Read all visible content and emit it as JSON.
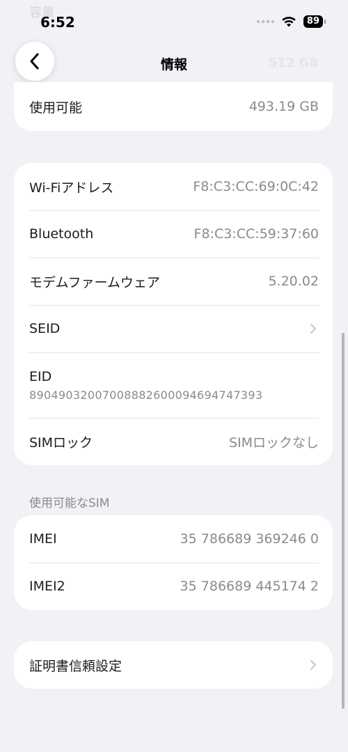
{
  "status_bar": {
    "time": "6:52",
    "battery": "89"
  },
  "ghost": {
    "top_label": "容量",
    "right_value": "512 GB"
  },
  "nav": {
    "title": "情報"
  },
  "storage": {
    "available_label": "使用可能",
    "available_value": "493.19 GB"
  },
  "network": {
    "rows": [
      {
        "label": "Wi-Fiアドレス",
        "value": "F8:C3:CC:69:0C:42"
      },
      {
        "label": "Bluetooth",
        "value": "F8:C3:CC:59:37:60"
      },
      {
        "label": "モデムファームウェア",
        "value": "5.20.02"
      },
      {
        "label": "SEID"
      }
    ],
    "eid": {
      "label": "EID",
      "value": "89049032007008882600094694747393"
    },
    "sim_lock": {
      "label": "SIMロック",
      "value": "SIMロックなし"
    }
  },
  "available_sim": {
    "header": "使用可能なSIM",
    "rows": [
      {
        "label": "IMEI",
        "value": "35 786689 369246 0"
      },
      {
        "label": "IMEI2",
        "value": "35 786689 445174 2"
      }
    ]
  },
  "certificate": {
    "label": "証明書信頼設定"
  },
  "colors": {
    "background": "#f2f1f6",
    "card": "#ffffff",
    "secondary_text": "#8a8a8e",
    "separator": "#e3e3e6"
  }
}
